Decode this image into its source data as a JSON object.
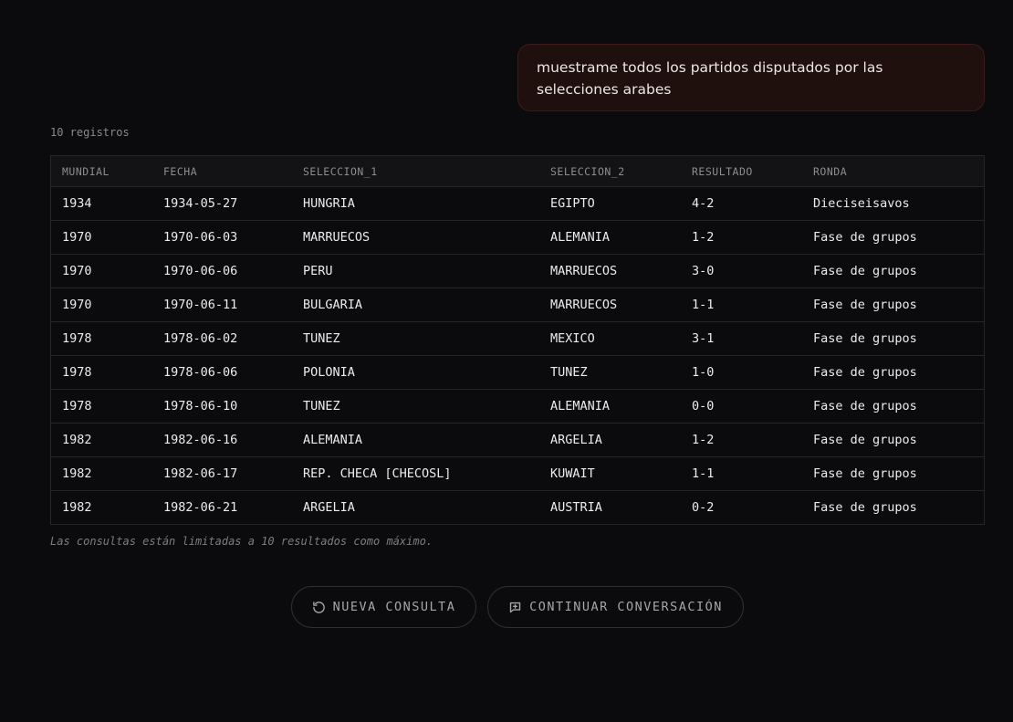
{
  "chat": {
    "user_message": "muestrame todos los partidos disputados por las selecciones arabes"
  },
  "results": {
    "count_label": "10 registros",
    "columns": [
      "MUNDIAL",
      "FECHA",
      "SELECCION_1",
      "SELECCION_2",
      "RESULTADO",
      "RONDA"
    ],
    "rows": [
      [
        "1934",
        "1934-05-27",
        "HUNGRIA",
        "EGIPTO",
        "4-2",
        "Dieciseisavos"
      ],
      [
        "1970",
        "1970-06-03",
        "MARRUECOS",
        "ALEMANIA",
        "1-2",
        "Fase de grupos"
      ],
      [
        "1970",
        "1970-06-06",
        "PERU",
        "MARRUECOS",
        "3-0",
        "Fase de grupos"
      ],
      [
        "1970",
        "1970-06-11",
        "BULGARIA",
        "MARRUECOS",
        "1-1",
        "Fase de grupos"
      ],
      [
        "1978",
        "1978-06-02",
        "TUNEZ",
        "MEXICO",
        "3-1",
        "Fase de grupos"
      ],
      [
        "1978",
        "1978-06-06",
        "POLONIA",
        "TUNEZ",
        "1-0",
        "Fase de grupos"
      ],
      [
        "1978",
        "1978-06-10",
        "TUNEZ",
        "ALEMANIA",
        "0-0",
        "Fase de grupos"
      ],
      [
        "1982",
        "1982-06-16",
        "ALEMANIA",
        "ARGELIA",
        "1-2",
        "Fase de grupos"
      ],
      [
        "1982",
        "1982-06-17",
        "REP. CHECA [CHECOSL]",
        "KUWAIT",
        "1-1",
        "Fase de grupos"
      ],
      [
        "1982",
        "1982-06-21",
        "ARGELIA",
        "AUSTRIA",
        "0-2",
        "Fase de grupos"
      ]
    ],
    "limit_note": "Las consultas están limitadas a 10 resultados como máximo."
  },
  "actions": {
    "new_query": {
      "label": "NUEVA CONSULTA",
      "icon": "refresh-icon"
    },
    "continue": {
      "label": "CONTINUAR CONVERSACIÓN",
      "icon": "chat-plus-icon"
    }
  },
  "colors": {
    "background": "#0b0b0d",
    "bubble_bg": "#1f100e",
    "bubble_border": "#3d1c18",
    "table_border": "#26262a",
    "muted_text": "#8a8a8a"
  }
}
